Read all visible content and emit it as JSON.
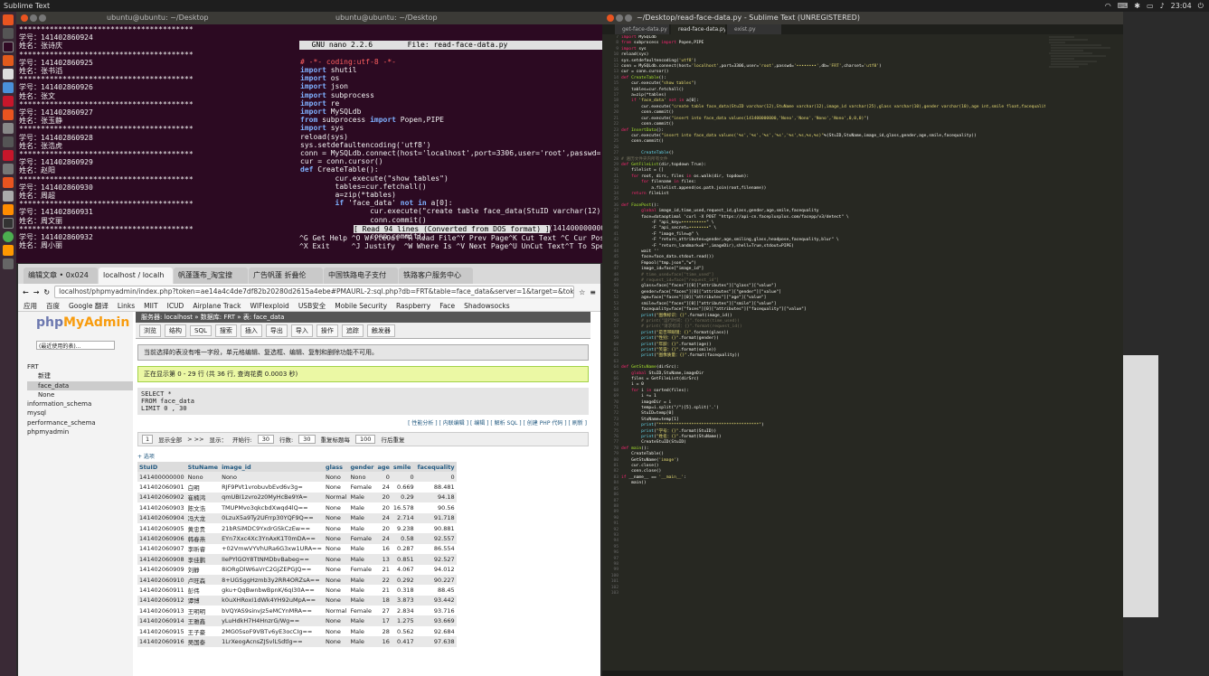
{
  "topbar": {
    "app": "Sublime Text",
    "time": "23:04"
  },
  "term1": {
    "title": "ubuntu@ubuntu: ~/Desktop",
    "lines": [
      "****************************************",
      "学号：141402860924",
      "姓名：张诗庆",
      "****************************************",
      "学号：141402860925",
      "姓名：张书滔",
      "****************************************",
      "学号：141402860926",
      "姓名：张文",
      "****************************************",
      "学号：141402860927",
      "姓名：张玉静",
      "****************************************",
      "学号：141402860928",
      "姓名：张浩虎",
      "****************************************",
      "学号：141402860929",
      "姓名：赵阳",
      "****************************************",
      "学号：141402860930",
      "姓名：周超",
      "****************************************",
      "学号：141402860931",
      "姓名：周文丽",
      "****************************************",
      "学号：141402860932",
      "姓名：周小丽"
    ]
  },
  "term2": {
    "title": "ubuntu@ubuntu: ~/Desktop",
    "header": "  GNU nano 2.2.6        File: read-face-data.py",
    "status": "[ Read 94 lines (Converted from DOS format) ]",
    "help1": "^G Get Help ^O WriteOut ^R Read File^Y Prev Page^K Cut Text ^C Cur Pos",
    "help2": "^X Exit     ^J Justify  ^W Where Is ^V Next Page^U UnCut Text^T To Spell"
  },
  "browser": {
    "tabs": [
      "编辑文章 • 0x024",
      "localhost / localh",
      "帆蓬篷布_淘宝搜",
      "广告帆蓬 折叠伦",
      "中国铁路电子支付",
      "铁路客户服务中心"
    ],
    "url": "localhost/phpmyadmin/index.php?token=ae14a4c4de7df82b20280d2615a4ebe#PMAURL-2:sql.php?db=FRT&table=face_data&server=1&target=&token=ae14",
    "bookmarks": [
      "应用",
      "百度",
      "Google 翻译",
      "Links",
      "MIIT",
      "ICUD",
      "Airplane Track",
      "WIFIexploid",
      "USB安全",
      "Mobile Security",
      "Raspberry",
      "Face",
      "Shadowsocks"
    ]
  },
  "pma": {
    "logo1": "php",
    "logo2": "MyAdmin",
    "recent": "(最近使用的表)...",
    "tree": [
      "FRT",
      "新建",
      "face_data",
      "None",
      "information_schema",
      "mysql",
      "performance_schema",
      "phpmyadmin"
    ],
    "crumb": "服务器: localhost  »  数据库: FRT  »  表: face_data",
    "menu": [
      "浏览",
      "结构",
      "SQL",
      "搜索",
      "插入",
      "导出",
      "导入",
      "操作",
      "追踪",
      "触发器"
    ],
    "note1": "当前选择的表没有唯一字段，单元格编辑、复选框、编辑、复制和删除功能不可用。",
    "note2": "正在显示第 0 - 29 行 (共 36 行, 查询花费 0.0003 秒)",
    "sql": [
      "SELECT *",
      "FROM  face_data",
      "LIMIT 0 , 30"
    ],
    "sqltools": "[ 性能分析 ] [ 内联编辑 ] [ 编辑 ] [ 解析 SQL ] [ 创建 PHP 代码 ] [ 刷新 ]",
    "pager": {
      "page": "1",
      "show_all": "显示全部",
      "sep": "> >>",
      "start_label": "显示：",
      "rows_from": "开始行:",
      "from": "30",
      "rows_label": "行数:",
      "rows": "30",
      "headers_label": "重复标题每",
      "headers": "100",
      "headers_after": "行后重复"
    },
    "options": "+ 选项",
    "columns": [
      "StuID",
      "StuName",
      "image_id",
      "glass",
      "gender",
      "age",
      "smile",
      "facequality"
    ],
    "rows": [
      [
        "141400000000",
        "Nono",
        "Nono",
        "Nono",
        "Nono",
        "0",
        "0",
        "0"
      ],
      [
        "141402060901",
        "白明",
        "RJF9PVt1vrobuvbEvd6v3g=",
        "None",
        "Female",
        "24",
        "0.669",
        "88.481"
      ],
      [
        "141402060902",
        "崔楠鸿",
        "qmUBI1zvro2z0MyHcBe9YA=",
        "Normal",
        "Male",
        "20",
        "0.29",
        "94.18"
      ],
      [
        "141402060903",
        "陈文浩",
        "TMUPMvo3qkcbdXwqd4lQ==",
        "None",
        "Male",
        "20",
        "16.578",
        "90.56"
      ],
      [
        "141402060904",
        "冯大龙",
        "0LzuX5a9Ty2UFrrp30YQF9Q==",
        "None",
        "Male",
        "24",
        "2.714",
        "91.718"
      ],
      [
        "141402060905",
        "黄忠贵",
        "21bRSiMDC9YxdrGSkCzEw==",
        "None",
        "Male",
        "20",
        "9.238",
        "90.881"
      ],
      [
        "141402060906",
        "韩春燕",
        "EYn7Xxc4Xc3YnAxK1T0mDA==",
        "None",
        "Female",
        "24",
        "0.58",
        "92.557"
      ],
      [
        "141402060907",
        "李昕睿",
        "+02VmwVYVhURa6G3xw1URA==",
        "None",
        "Male",
        "16",
        "0.287",
        "86.554"
      ],
      [
        "141402060908",
        "李佳鹏",
        "IIePYlGOY8TtNMDbvBabeg==",
        "None",
        "Male",
        "13",
        "0.851",
        "92.527"
      ],
      [
        "141402060909",
        "刘静",
        "8iORgDlW6aVrC2GJZEPGJQ==",
        "None",
        "Female",
        "21",
        "4.067",
        "94.012"
      ],
      [
        "141402060910",
        "卢旺森",
        "8+UGSggHzmb3y2RR4ORZsA==",
        "None",
        "Male",
        "22",
        "0.292",
        "90.227"
      ],
      [
        "141402060911",
        "彭伟",
        "gku+QqBwnbwBpnK/6qI30A==",
        "None",
        "Male",
        "21",
        "0.318",
        "88.45"
      ],
      [
        "141402060912",
        "谭博",
        "k0uXHRoxI1dWk4YH92uMpA==",
        "None",
        "Male",
        "18",
        "3.873",
        "93.442"
      ],
      [
        "141402060913",
        "王明明",
        "bVQYAS9sinvJz5eMCYnMRA==",
        "Normal",
        "Female",
        "27",
        "2.834",
        "93.716"
      ],
      [
        "141402060914",
        "王雅鑫",
        "yLuHdkH7H4HnzrG/Wg==",
        "None",
        "Male",
        "17",
        "1.275",
        "93.669"
      ],
      [
        "141402060915",
        "王子豪",
        "2MG05soF9VBTv6yE3ocCIg==",
        "None",
        "Male",
        "28",
        "0.562",
        "92.684"
      ],
      [
        "141402060916",
        "吴国泰",
        "1LrXeogAcnsZJSvlLSdtlg==",
        "None",
        "Male",
        "16",
        "0.417",
        "97.638"
      ]
    ]
  },
  "sublime": {
    "title": "~/Desktop/read-face-data.py - Sublime Text (UNREGISTERED)",
    "tabs": [
      "get-face-data.py",
      "read-face-data.py",
      "exist.py"
    ]
  }
}
